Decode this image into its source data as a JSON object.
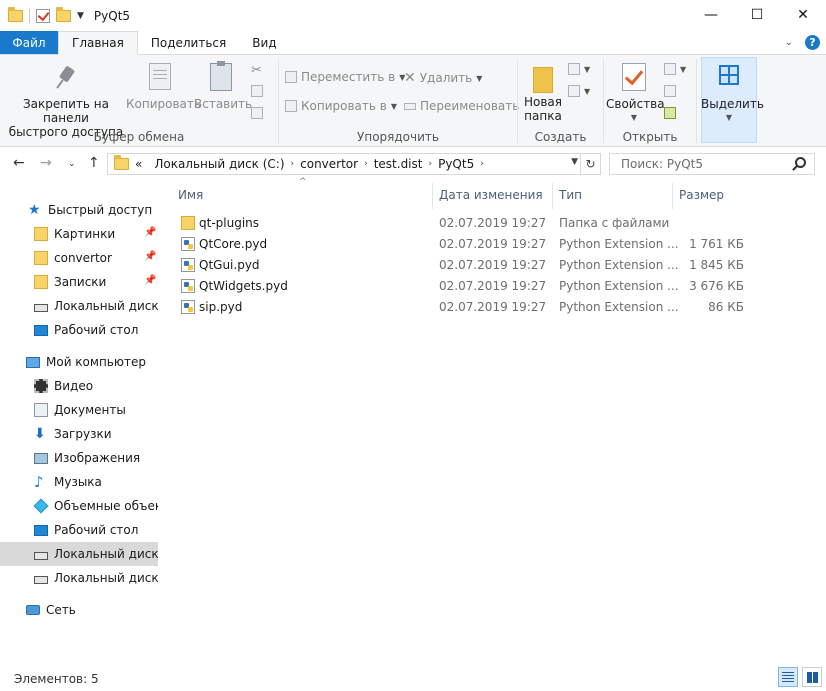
{
  "window": {
    "title": "PyQt5",
    "minimize": "—",
    "maximize": "☐",
    "close": "✕"
  },
  "ribbon_tabs": {
    "file": "Файл",
    "home": "Главная",
    "share": "Поделиться",
    "view": "Вид",
    "expand_icon": "chevron-down-icon",
    "help_icon": "help-icon"
  },
  "ribbon": {
    "clipboard": {
      "pin_line1": "Закрепить на панели",
      "pin_line2": "быстрого доступа",
      "copy": "Копировать",
      "paste": "Вставить",
      "label": "Буфер обмена"
    },
    "organize": {
      "move_to": "Переместить в",
      "copy_to": "Копировать в",
      "delete": "Удалить",
      "rename": "Переименовать",
      "label": "Упорядочить"
    },
    "new": {
      "new_folder_line1": "Новая",
      "new_folder_line2": "папка",
      "label": "Создать"
    },
    "open": {
      "properties": "Свойства",
      "label": "Открыть"
    },
    "select": {
      "select": "Выделить"
    }
  },
  "address": {
    "overflow": "«",
    "segments": [
      "Локальный диск (C:)",
      "convertor",
      "test.dist",
      "PyQt5"
    ],
    "search_placeholder": "Поиск: PyQt5"
  },
  "nav_pane": {
    "quick_access": "Быстрый доступ",
    "quick_items": [
      {
        "label": "Картинки",
        "pinned": true
      },
      {
        "label": "convertor",
        "pinned": true
      },
      {
        "label": "Записки",
        "pinned": true
      },
      {
        "label": "Локальный диск (C",
        "pinned": false
      },
      {
        "label": "Рабочий стол",
        "pinned": false
      }
    ],
    "this_pc": "Мой компьютер",
    "pc_items": [
      {
        "label": "Видео"
      },
      {
        "label": "Документы"
      },
      {
        "label": "Загрузки"
      },
      {
        "label": "Изображения"
      },
      {
        "label": "Музыка"
      },
      {
        "label": "Объемные объекты"
      },
      {
        "label": "Рабочий стол"
      },
      {
        "label": "Локальный диск (C"
      },
      {
        "label": "Локальный диск (D"
      }
    ],
    "network": "Сеть"
  },
  "columns": {
    "name": "Имя",
    "date": "Дата изменения",
    "type": "Тип",
    "size": "Размер"
  },
  "files": [
    {
      "name": "qt-plugins",
      "date": "02.07.2019 19:27",
      "type": "Папка с файлами",
      "size": "",
      "icon": "folder-icon"
    },
    {
      "name": "QtCore.pyd",
      "date": "02.07.2019 19:27",
      "type": "Python Extension ...",
      "size": "1 761 КБ",
      "icon": "python-file-icon"
    },
    {
      "name": "QtGui.pyd",
      "date": "02.07.2019 19:27",
      "type": "Python Extension ...",
      "size": "1 845 КБ",
      "icon": "python-file-icon"
    },
    {
      "name": "QtWidgets.pyd",
      "date": "02.07.2019 19:27",
      "type": "Python Extension ...",
      "size": "3 676 КБ",
      "icon": "python-file-icon"
    },
    {
      "name": "sip.pyd",
      "date": "02.07.2019 19:27",
      "type": "Python Extension ...",
      "size": "86 КБ",
      "icon": "python-file-icon"
    }
  ],
  "status": {
    "item_count": "Элементов: 5"
  },
  "colors": {
    "file_tab": "#1979ca",
    "ribbon_bg": "#f5f6f7",
    "selected_nav": "#d9d9d9",
    "column_header": "#4c607a"
  }
}
